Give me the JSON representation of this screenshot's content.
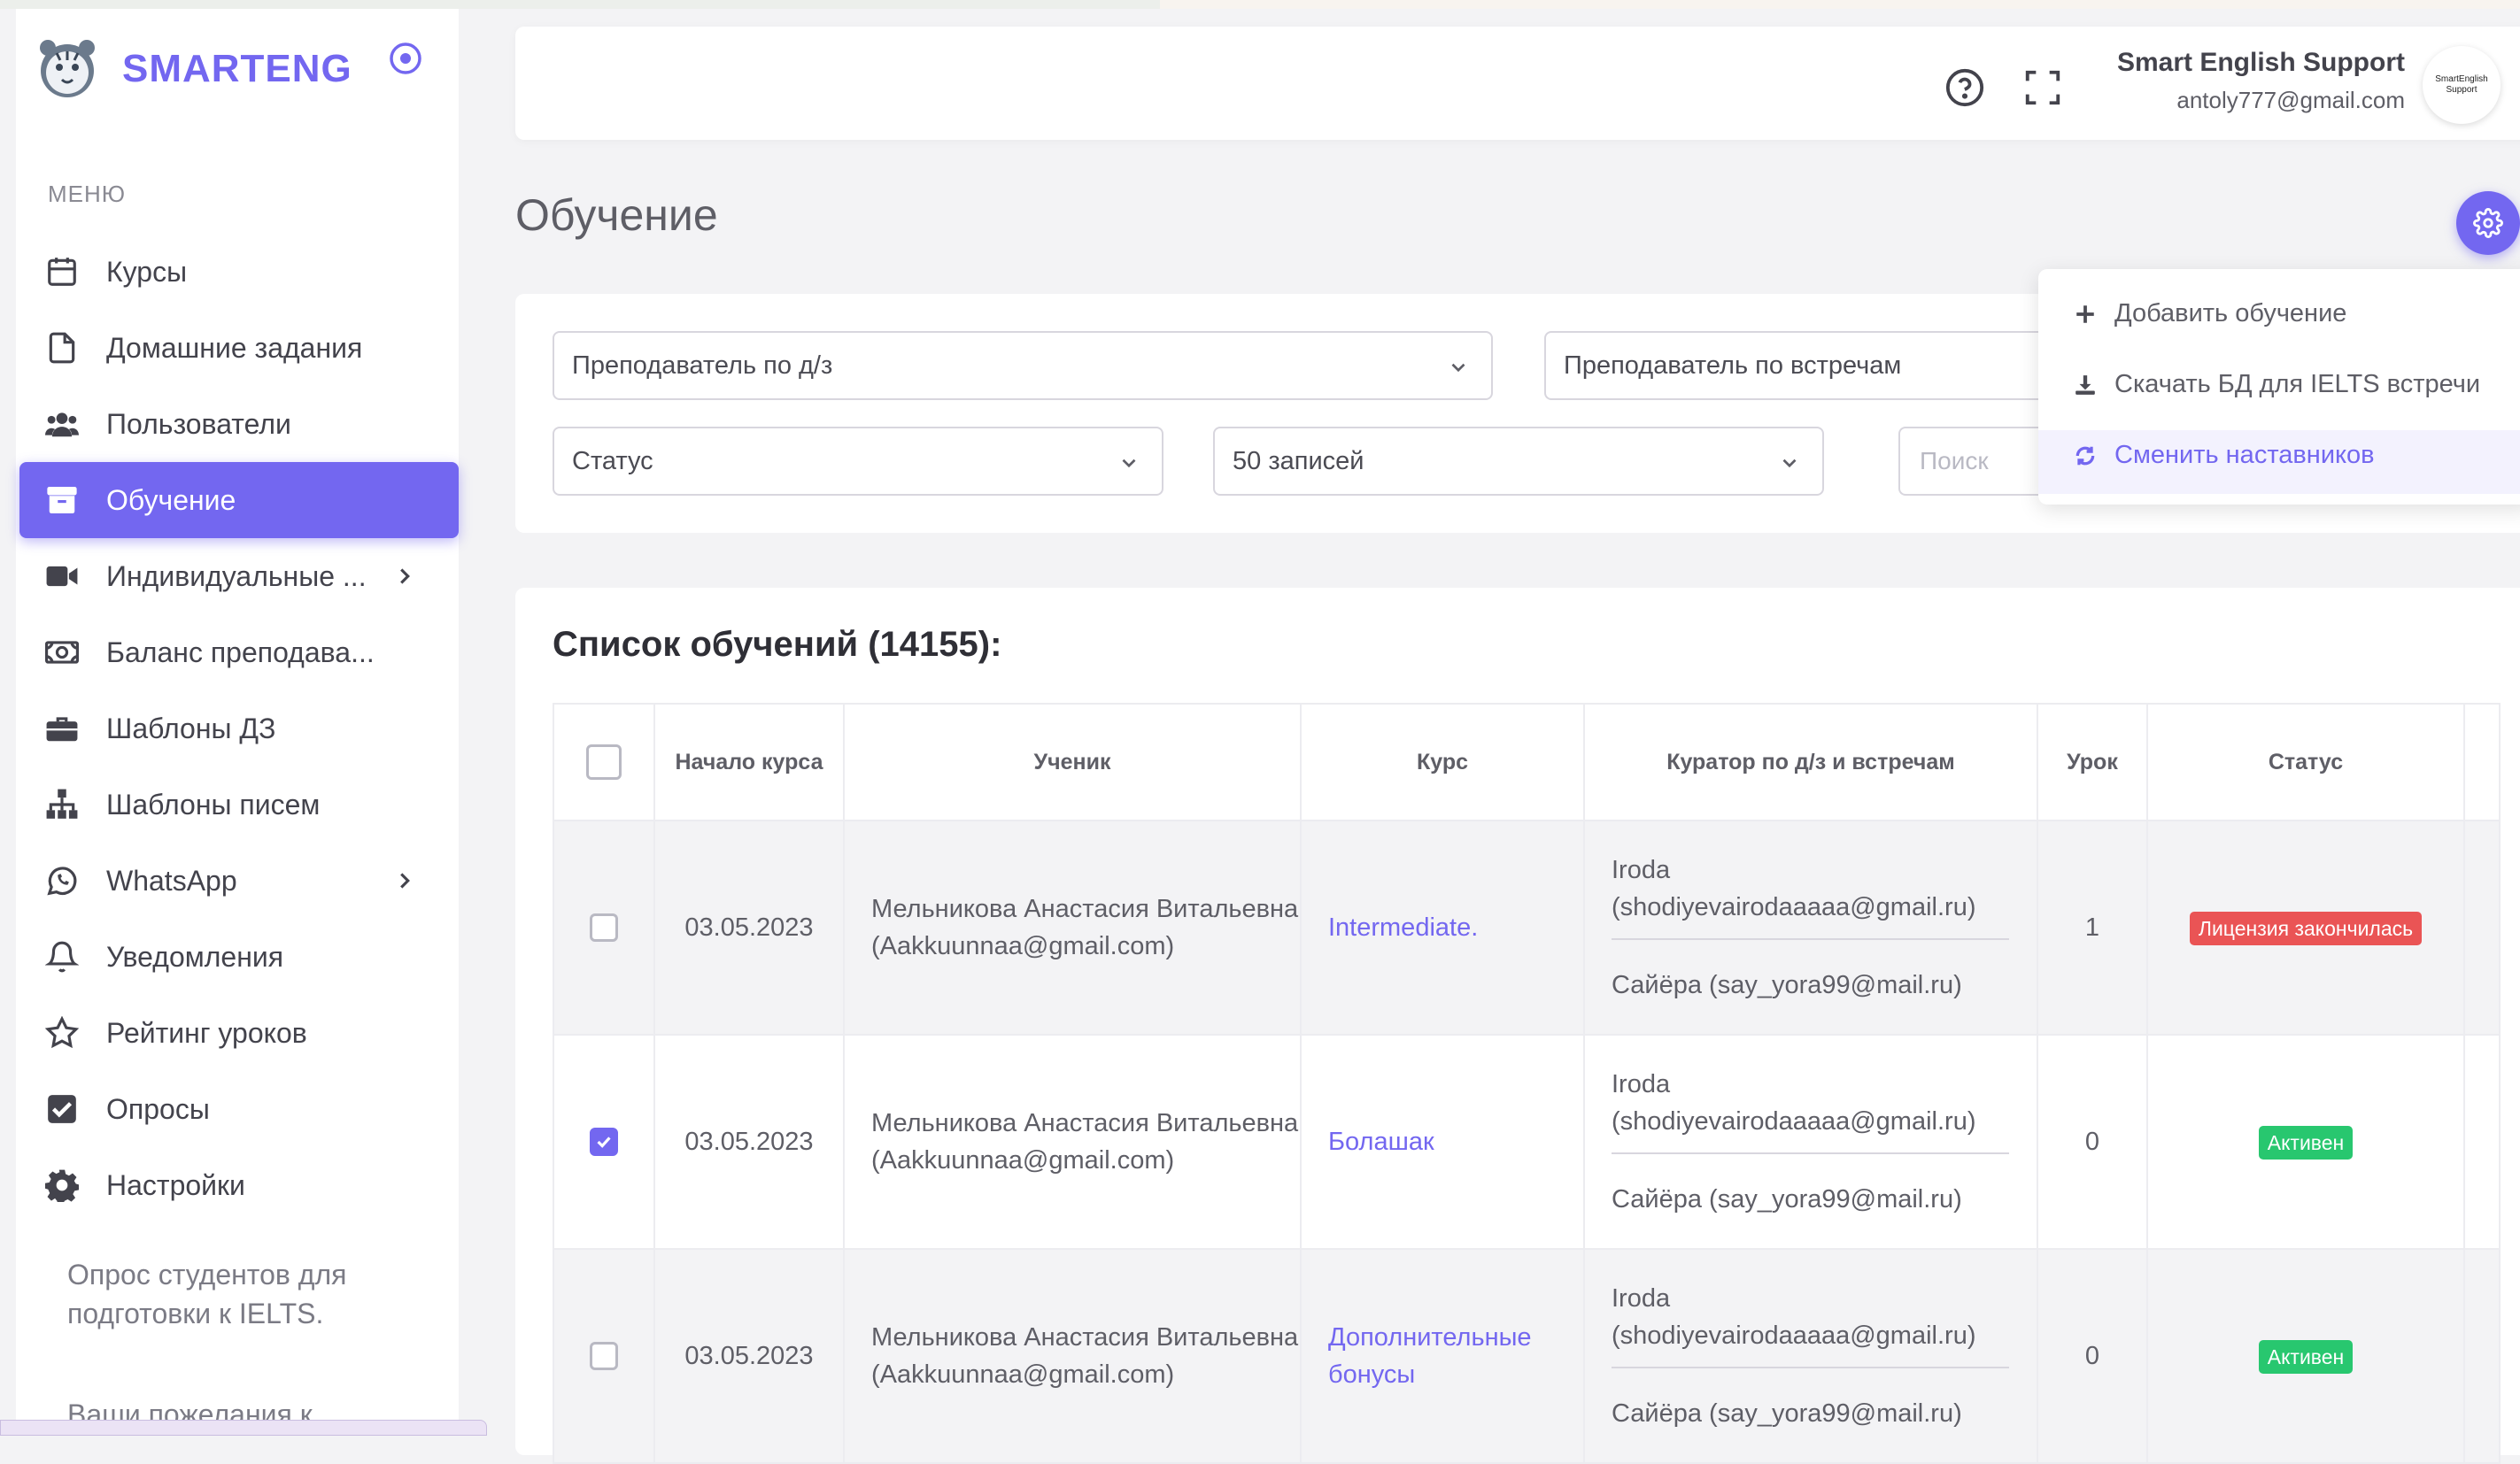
{
  "app": {
    "brand": "SMARTENG",
    "menu_heading": "МЕНЮ"
  },
  "colors": {
    "accent": "#7367f0",
    "danger": "#ea5455",
    "success": "#28c76f"
  },
  "sidebar": {
    "items": [
      {
        "label": "Курсы",
        "icon": "calendar-icon"
      },
      {
        "label": "Домашние задания",
        "icon": "file-icon"
      },
      {
        "label": "Пользователи",
        "icon": "users-icon"
      },
      {
        "label": "Обучение",
        "icon": "archive-icon",
        "active": true
      },
      {
        "label": "Индивидуальные ...",
        "icon": "video-icon",
        "has_submenu": true
      },
      {
        "label": "Баланс преподава...",
        "icon": "money-icon"
      },
      {
        "label": "Шаблоны ДЗ",
        "icon": "briefcase-icon"
      },
      {
        "label": "Шаблоны писем",
        "icon": "sitemap-icon"
      },
      {
        "label": "WhatsApp",
        "icon": "whatsapp-icon",
        "has_submenu": true
      },
      {
        "label": "Уведомления",
        "icon": "bell-icon"
      },
      {
        "label": "Рейтинг уроков",
        "icon": "star-icon"
      },
      {
        "label": "Опросы",
        "icon": "check-square-icon"
      },
      {
        "label": "Настройки",
        "icon": "gear-icon"
      }
    ],
    "note": "Опрос студентов для подготовки к IELTS.",
    "note2": "Ваши пожелания к"
  },
  "header": {
    "user_name": "Smart English Support",
    "user_email": "antoly777@gmail.com",
    "avatar_text": "SmartEnglish Support"
  },
  "page": {
    "title": "Обучение"
  },
  "filters": {
    "hw_teacher": "Преподаватель по д/з",
    "meeting_teacher": "Преподаватель по встречам",
    "status": "Статус",
    "records": "50 записей",
    "search_placeholder": "Поиск"
  },
  "actions_menu": {
    "items": [
      {
        "label": "Добавить обучение",
        "icon": "plus-icon"
      },
      {
        "label": "Скачать БД для IELTS встречи",
        "icon": "download-icon"
      },
      {
        "label": "Сменить наставников",
        "icon": "refresh-icon",
        "highlighted": true
      }
    ]
  },
  "list": {
    "title": "Список обучений (14155):",
    "columns": [
      "Начало курса",
      "Ученик",
      "Курс",
      "Куратор по д/з и встречам",
      "Урок",
      "Статус"
    ],
    "rows": [
      {
        "checked": false,
        "start": "03.05.2023",
        "student": "Мельникова Анастасия Витальевна (Aakkuunnaa@gmail.com)",
        "course": "Intermediate.",
        "curator1": "Iroda (shodiyevairodaaaaa@gmail.ru)",
        "curator2": "Сайёра (say_yora99@mail.ru)",
        "lesson": "1",
        "status": "Лицензия закончилась",
        "status_color": "#ea5455"
      },
      {
        "checked": true,
        "start": "03.05.2023",
        "student": "Мельникова Анастасия Витальевна (Aakkuunnaa@gmail.com)",
        "course": "Болашак",
        "curator1": "Iroda (shodiyevairodaaaaa@gmail.ru)",
        "curator2": "Сайёра (say_yora99@mail.ru)",
        "lesson": "0",
        "status": "Активен",
        "status_color": "#28c76f"
      },
      {
        "checked": false,
        "start": "03.05.2023",
        "student": "Мельникова Анастасия Витальевна (Aakkuunnaa@gmail.com)",
        "course": "Дополнительные бонусы",
        "curator1": "Iroda (shodiyevairodaaaaa@gmail.ru)",
        "curator2": "Сайёра (say_yora99@mail.ru)",
        "lesson": "0",
        "status": "Активен",
        "status_color": "#28c76f"
      }
    ]
  }
}
